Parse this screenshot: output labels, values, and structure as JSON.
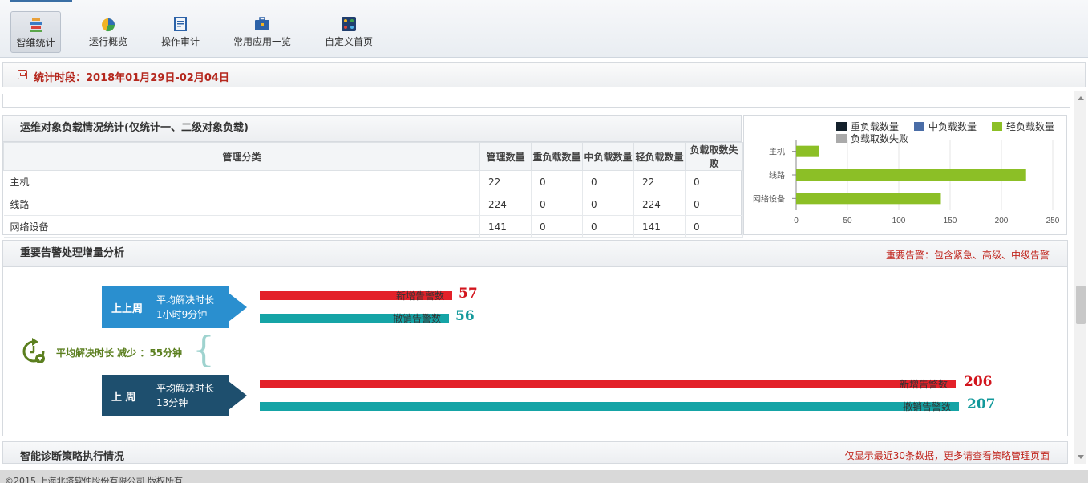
{
  "toolbar": {
    "items": [
      {
        "label": "智维统计",
        "icon": "stats-books-icon",
        "active": true
      },
      {
        "label": "运行概览",
        "icon": "pie-chart-icon",
        "active": false
      },
      {
        "label": "操作审计",
        "icon": "audit-doc-icon",
        "active": false
      },
      {
        "label": "常用应用一览",
        "icon": "briefcase-icon",
        "active": false
      },
      {
        "label": "自定义首页",
        "icon": "custom-home-icon",
        "active": false
      }
    ]
  },
  "period": {
    "text": "统计时段：2018年01月29日-02月04日"
  },
  "load_stats": {
    "title": "运维对象负载情况统计(仅统计一、二级对象负载)",
    "columns": [
      "管理分类",
      "管理数量",
      "重负载数量",
      "中负载数量",
      "轻负载数量",
      "负载取数失败"
    ],
    "rows": [
      [
        "主机",
        "22",
        "0",
        "0",
        "22",
        "0"
      ],
      [
        "线路",
        "224",
        "0",
        "0",
        "224",
        "0"
      ],
      [
        "网络设备",
        "141",
        "0",
        "0",
        "141",
        "0"
      ]
    ]
  },
  "chart_data": {
    "type": "bar",
    "orientation": "horizontal",
    "categories": [
      "主机",
      "线路",
      "网络设备"
    ],
    "series": [
      {
        "name": "重负载数量",
        "values": [
          0,
          0,
          0
        ],
        "color": "#13202b"
      },
      {
        "name": "中负载数量",
        "values": [
          0,
          0,
          0
        ],
        "color": "#4a6da7"
      },
      {
        "name": "轻负载数量",
        "values": [
          22,
          224,
          141
        ],
        "color": "#8cbf26"
      },
      {
        "name": "负载取数失败",
        "values": [
          0,
          0,
          0
        ],
        "color": "#aaaaaa"
      }
    ],
    "xlim": [
      0,
      250
    ],
    "xticks": [
      "0",
      "50",
      "100",
      "150",
      "200",
      "250"
    ],
    "grid": true,
    "legend": "top"
  },
  "alarms": {
    "title": "重要告警处理增量分析",
    "note": "重要告警：包含紧急、高级、中级告警",
    "reduce_text": "平均解决时长 减少 ：55分钟",
    "max_value": 207,
    "weeks": [
      {
        "name": "上上周",
        "label": "平均解决时长",
        "duration": "1小时9分钟",
        "color": "#2a8fcf",
        "new_label": "新增告警数",
        "new_value": 57,
        "cancel_label": "撤销告警数",
        "cancel_value": 56
      },
      {
        "name": "上 周",
        "label": "平均解决时长",
        "duration": "13分钟",
        "color": "#1e4f6e",
        "new_label": "新增告警数",
        "new_value": 206,
        "cancel_label": "撤销告警数",
        "cancel_value": 207
      }
    ]
  },
  "diagnosis": {
    "title": "智能诊断策略执行情况",
    "note": "仅显示最近30条数据，更多请查看策略管理页面"
  },
  "footer": {
    "text": "©2015 上海北塔软件股份有限公司 版权所有"
  }
}
